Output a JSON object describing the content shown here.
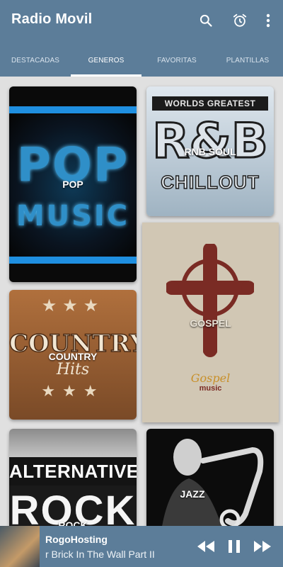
{
  "app": {
    "title": "Radio Movil"
  },
  "toolbar": {
    "icons": [
      "search-icon",
      "alarm-clock-icon",
      "more-vert-icon"
    ]
  },
  "tabs": [
    {
      "label": "DESTACADAS",
      "active": false
    },
    {
      "label": "GENEROS",
      "active": true
    },
    {
      "label": "FAVORITAS",
      "active": false
    },
    {
      "label": "PLANTILLAS",
      "active": false
    }
  ],
  "genres": {
    "pop": {
      "label": "POP",
      "art_top": "POP",
      "art_bottom": "MUSIC"
    },
    "rnb": {
      "label": "RNB SOUL",
      "art_header": "WORLDS GREATEST",
      "art_main": "R&B",
      "art_sub": "CHILLOUT"
    },
    "gospel": {
      "label": "GOSPEL",
      "art_script": "Gospel",
      "art_music": "music"
    },
    "country": {
      "label": "COUNTRY",
      "art_main": "COUNTRY",
      "art_sub": "Hits"
    },
    "rock": {
      "label": "ROCK",
      "art_top": "ALTERNATIVE",
      "art_main": "ROCK"
    },
    "jazz": {
      "label": "JAZZ"
    }
  },
  "player": {
    "station": "RogoHosting",
    "track": "r Brick In The Wall Part II",
    "controls": [
      "rewind-icon",
      "pause-icon",
      "fast-forward-icon"
    ]
  },
  "colors": {
    "primary": "#5c7d99",
    "background": "#e0e0e0",
    "pop_accent": "#1f8fe0",
    "gospel_cross": "#7a2b24"
  }
}
